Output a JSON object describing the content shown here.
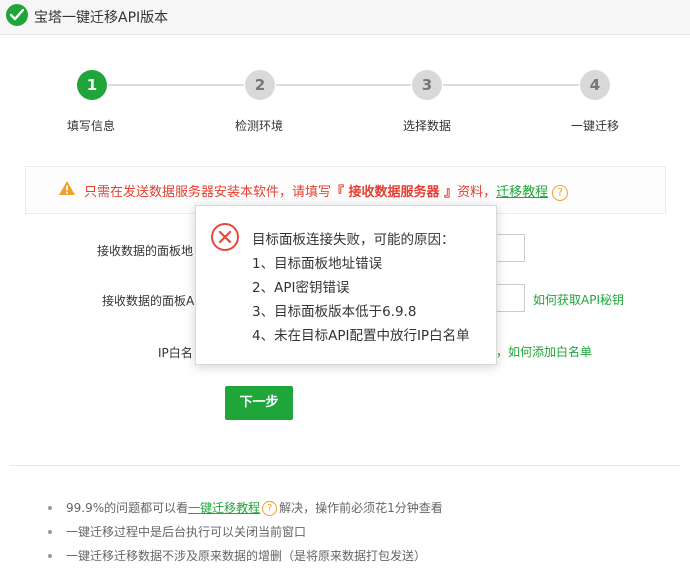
{
  "window": {
    "title": "宝塔一键迁移API版本"
  },
  "steps": [
    {
      "number": "1",
      "label": "填写信息",
      "active": true
    },
    {
      "number": "2",
      "label": "检测环境",
      "active": false
    },
    {
      "number": "3",
      "label": "选择数据",
      "active": false
    },
    {
      "number": "4",
      "label": "一键迁移",
      "active": false
    }
  ],
  "warning": {
    "text_before": "只需在发送数据服务器安装本软件，请填写",
    "highlight": "『 接收数据服务器 』",
    "text_after": "资料，",
    "link": "迁移教程",
    "help": "?"
  },
  "form": {
    "panel_address_label": "接收数据的面板地",
    "api_key_label": "接收数据的面板A",
    "api_key_link": "如何获取API秘钥",
    "ip_whitelist_label": "IP白名",
    "ip_whitelist_link": "，如何添加白名单",
    "next_button": "下一步"
  },
  "tips": [
    {
      "before": "99.9%的问题都可以看",
      "link": "一键迁移教程",
      "help": "?",
      "after": "解决，操作前必须花1分钟查看"
    },
    {
      "text": "一键迁移过程中是后台执行可以关闭当前窗口"
    },
    {
      "text": "一键迁移迁移数据不涉及原来数据的增删（是将原来数据打包发送）"
    }
  ],
  "error_popup": {
    "title": "目标面板连接失败，可能的原因：",
    "reasons": [
      "1、目标面板地址错误",
      "2、API密钥错误",
      "3、目标面板版本低于6.9.8",
      "4、未在目标API配置中放行IP白名单"
    ]
  },
  "colors": {
    "primary_green": "#20a53a",
    "warning_red": "#e43f32",
    "help_orange": "#f0a028",
    "error_icon_red": "#e8483c"
  },
  "icons": {
    "title": "check-circle-icon",
    "warning": "warning-triangle-icon",
    "help": "question-circle-icon",
    "error": "error-x-circle-icon"
  }
}
